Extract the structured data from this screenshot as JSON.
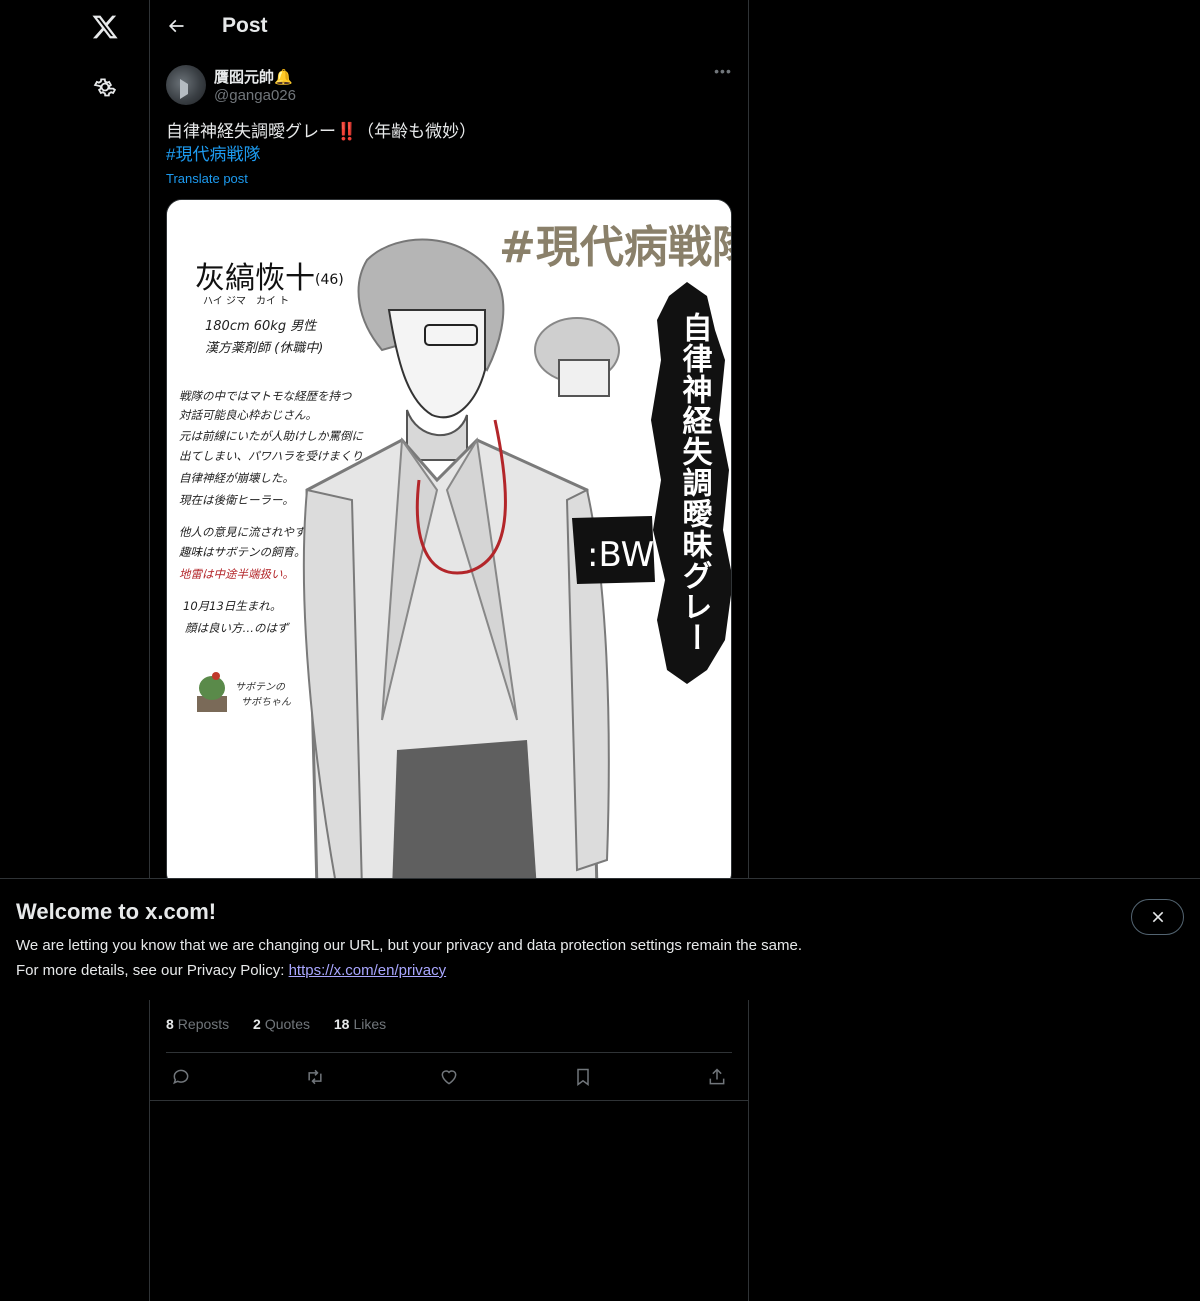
{
  "nav": {
    "logo_icon": "x-logo-icon",
    "settings_icon": "gear-icon"
  },
  "header": {
    "title": "Post",
    "back_icon": "arrow-left-icon"
  },
  "post": {
    "author_name": "贋囮元帥🔔",
    "author_handle": "@ganga026",
    "text_main": "自律神経失調曖グレー‼️（年齢も微妙）",
    "hashtag": "#現代病戦隊",
    "translate_label": "Translate post",
    "more_icon": "•••"
  },
  "image": {
    "hashtag_text": "#現代病戦隊",
    "name": "灰縞恢十",
    "age": "(46)",
    "reading": "ハイ ジマ　カイ ト",
    "stats": "180cm 60kg 男性",
    "job": "漢方薬剤師 (休職中)",
    "desc": [
      "戦隊の中ではマトモな経歴を持つ",
      "対話可能良心枠おじさん。",
      "元は前線にいたが人助けしか罵倒に",
      "出てしまい、パワハラを受けまくり",
      "自律神経が崩壊した。",
      "現在は後衛ヒーラー。",
      "他人の意見に流されやすい。",
      "趣味はサボテンの飼育。",
      "地雷は中途半端扱い。",
      "10月13日生まれ。",
      "顔は良い方…のはず"
    ],
    "cactus_label_1": "サボテンの",
    "cactus_label_2": "サボちゃん",
    "armband": ":BW",
    "vertical_title": "自律神経失調曖昧グレー"
  },
  "stats": {
    "reposts_count": "8",
    "reposts_label": "Reposts",
    "quotes_count": "2",
    "quotes_label": "Quotes",
    "likes_count": "18",
    "likes_label": "Likes"
  },
  "actions": [
    "reply-icon",
    "repost-icon",
    "like-icon",
    "bookmark-icon",
    "share-icon"
  ],
  "banner": {
    "title": "Welcome to x.com!",
    "line1": "We are letting you know that we are changing our URL, but your privacy and data protection settings remain the same.",
    "line2_prefix": "For more details, see our Privacy Policy: ",
    "link": "https://x.com/en/privacy",
    "close_icon": "close-icon"
  }
}
